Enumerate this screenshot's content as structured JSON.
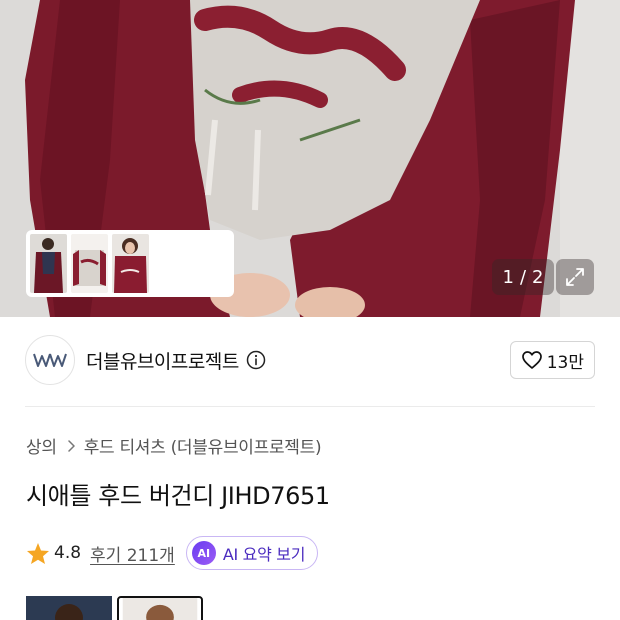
{
  "gallery": {
    "current_page": "1",
    "separator": "/",
    "total_pages": "2",
    "expand_icon": "expand-icon",
    "thumbnails": [
      "thumbnail-1",
      "thumbnail-2",
      "thumbnail-3"
    ]
  },
  "brand": {
    "logo_icon": "brand-logo-icon",
    "name": "더블유브이프로젝트",
    "info_icon": "info-icon",
    "like_icon": "heart-icon",
    "like_count": "13만"
  },
  "breadcrumb": {
    "category": "상의",
    "separator_icon": "chevron-right-icon",
    "subcategory": "후드 티셔츠 (더블유브이프로젝트)"
  },
  "product": {
    "title": "시애틀 후드 버건디 JIHD7651"
  },
  "rating": {
    "star_icon": "star-icon",
    "value": "4.8",
    "review_link": "후기 211개",
    "ai_badge": "AI",
    "ai_label": "AI 요약 보기"
  },
  "colors": {
    "accent_burgundy": "#7a1a2c",
    "star": "#f5a623",
    "ai_purple": "#6a3cf0"
  }
}
